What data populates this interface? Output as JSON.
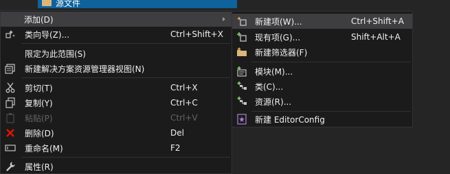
{
  "tree": {
    "selected_label": "源文件"
  },
  "context_menu": {
    "items": [
      {
        "label": "添加(D)"
      },
      {
        "label": "类向导(Z)...",
        "shortcut": "Ctrl+Shift+X"
      },
      {
        "label": "限定为此范围(S)"
      },
      {
        "label": "新建解决方案资源管理器视图(N)"
      },
      {
        "label": "剪切(T)",
        "shortcut": "Ctrl+X"
      },
      {
        "label": "复制(Y)",
        "shortcut": "Ctrl+C"
      },
      {
        "label": "粘贴(P)",
        "shortcut": "Ctrl+V"
      },
      {
        "label": "删除(D)",
        "shortcut": "Del"
      },
      {
        "label": "重命名(M)",
        "shortcut": "F2"
      },
      {
        "label": "属性(R)"
      }
    ]
  },
  "add_submenu": {
    "items": [
      {
        "label": "新建项(W)...",
        "shortcut": "Ctrl+Shift+A"
      },
      {
        "label": "现有项(G)...",
        "shortcut": "Shift+Alt+A"
      },
      {
        "label": "新建筛选器(F)"
      },
      {
        "label": "模块(M)..."
      },
      {
        "label": "类(C)..."
      },
      {
        "label": "资源(R)..."
      },
      {
        "label": "新建 EditorConfig"
      }
    ]
  },
  "colors": {
    "menu_background": "#1b1b1c",
    "hover_background": "#3e3e40",
    "selection_background": "#0e639c",
    "disabled_text": "#656565",
    "delete_icon": "#e51400"
  }
}
